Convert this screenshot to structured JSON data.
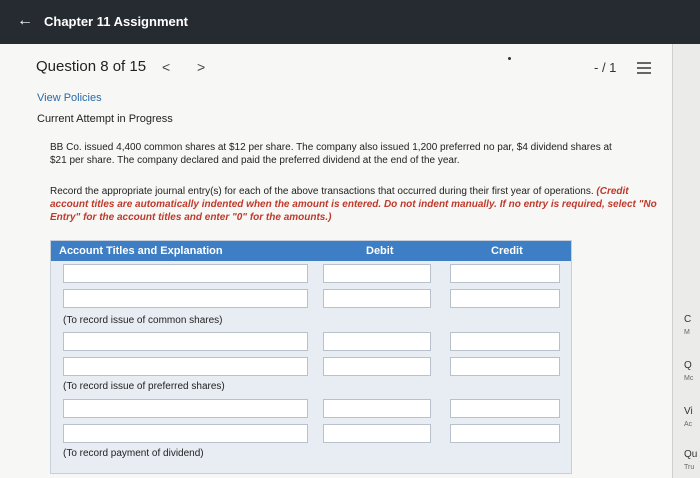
{
  "header": {
    "title": "Chapter 11 Assignment"
  },
  "question": {
    "label": "Question 8 of 15",
    "prev": "<",
    "next": ">",
    "score": "- / 1"
  },
  "links": {
    "view_policies": "View Policies"
  },
  "status": "Current Attempt in Progress",
  "problem": "BB Co. issued 4,400 common shares at $12 per share. The company also issued 1,200 preferred no par, $4 dividend shares at $21 per share. The company declared and paid the preferred dividend at the end of the year.",
  "instructions": {
    "plain": "Record the appropriate journal entry(s) for each of the above transactions that occurred during their first year of operations. ",
    "emphasis": "(Credit account titles are automatically indented when the amount is entered. Do not indent manually. If no entry is required, select \"No Entry\" for the account titles and enter \"0\" for the amounts.)"
  },
  "table": {
    "headers": {
      "account": "Account Titles and Explanation",
      "debit": "Debit",
      "credit": "Credit"
    },
    "memos": [
      "(To record issue of common shares)",
      "(To record issue of preferred shares)",
      "(To record payment of dividend)"
    ]
  },
  "rail": {
    "items": [
      {
        "big": "C",
        "small": "M"
      },
      {
        "big": "Q",
        "small": "Mc"
      },
      {
        "big": "Vi",
        "small": "Ac"
      },
      {
        "big": "Qu",
        "small": "Tru"
      }
    ]
  },
  "icons": {
    "back": "arrow-left-icon",
    "list": "list-icon"
  },
  "colors": {
    "topbar": "#262a31",
    "table_header": "#3d7ec4",
    "link": "#2a6aa8",
    "emphasis": "#c0392b"
  }
}
